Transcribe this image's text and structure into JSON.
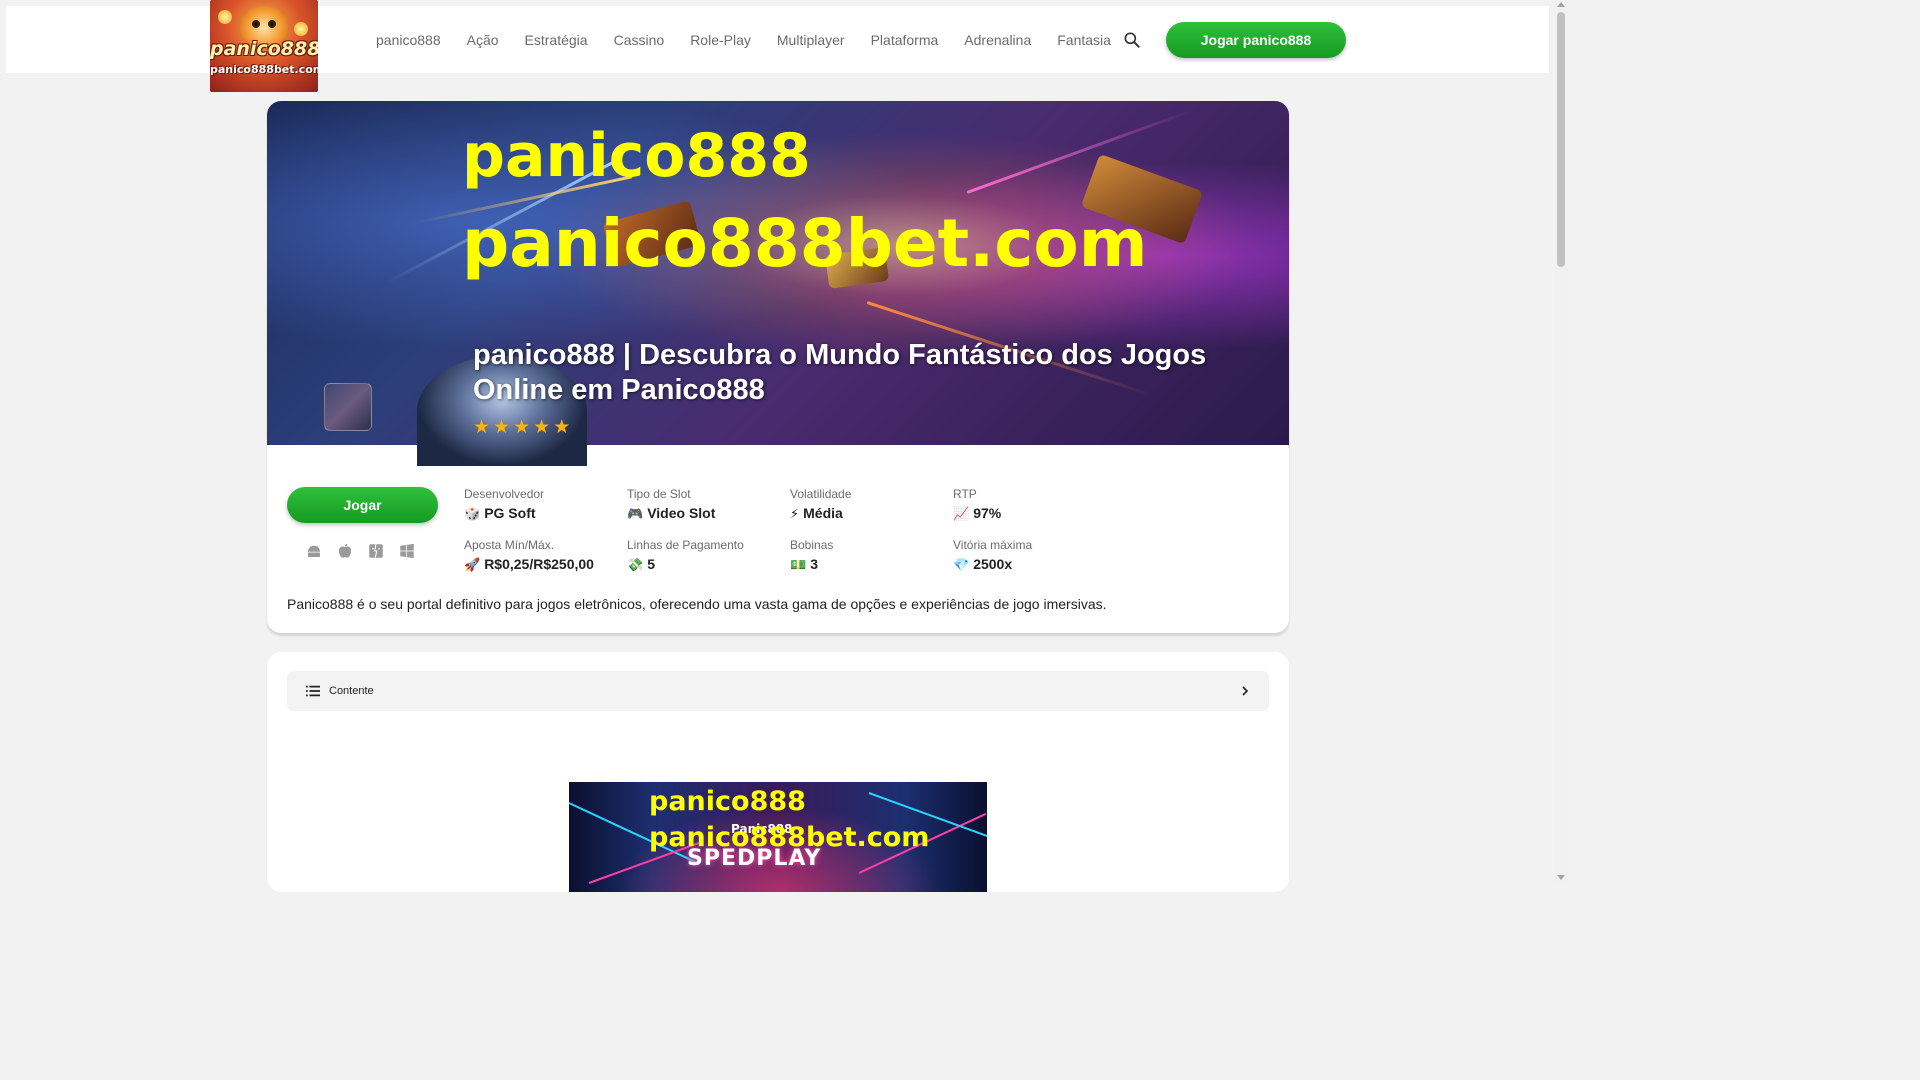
{
  "header": {
    "logo": {
      "line1": "panico888",
      "line2": "panico888bet.com"
    },
    "nav": [
      "panico888",
      "Ação",
      "Estratégia",
      "Cassino",
      "Role-Play",
      "Multiplayer",
      "Plataforma",
      "Adrenalina",
      "Fantasia"
    ],
    "search_icon": "search-icon",
    "cta_label": "Jogar panico888"
  },
  "hero": {
    "overlay_line1": "panico888",
    "overlay_line2": "panico888bet.com",
    "title": "panico888 | Descubra o Mundo Fantástico dos Jogos Online em Panico888",
    "rating": 5
  },
  "game": {
    "play_label": "Jogar",
    "platforms": [
      "android-icon",
      "apple-icon",
      "mac-finder-icon",
      "windows-icon"
    ],
    "info": [
      {
        "label": "Desenvolvedor",
        "emoji": "🎲",
        "value": "PG Soft"
      },
      {
        "label": "Tipo de Slot",
        "emoji": "🎮",
        "value": "Video Slot"
      },
      {
        "label": "Volatilidade",
        "emoji": "⚡",
        "value": "Média"
      },
      {
        "label": "RTP",
        "emoji": "📈",
        "value": "97%"
      },
      {
        "label": "Aposta Mín/Máx.",
        "emoji": "🚀",
        "value": "R$0,25/R$250,00"
      },
      {
        "label": "Linhas de Pagamento",
        "emoji": "💸",
        "value": "5"
      },
      {
        "label": "Bobinas",
        "emoji": "💵",
        "value": "3"
      },
      {
        "label": "Vitória máxima",
        "emoji": "💎",
        "value": "2500x"
      }
    ],
    "description": "Panico888 é o seu portal definitivo para jogos eletrônicos, oferecendo uma vasta gama de opções e experiências de jogo imersivas."
  },
  "toc": {
    "label": "Contente"
  },
  "banner2": {
    "line1": "panico888",
    "line2": "panico888bet.com",
    "brand": "Panic888",
    "play_text": "SPEDPLAY"
  },
  "colors": {
    "accent_green": "#1fae2c",
    "overlay_yellow": "#ffff00",
    "star": "#f5b31c"
  }
}
